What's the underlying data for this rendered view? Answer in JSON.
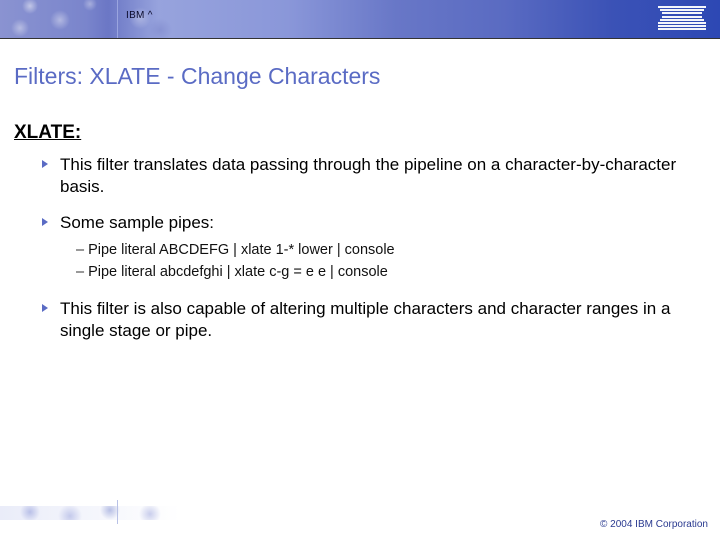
{
  "header": {
    "brand_left": "IBM ^",
    "brand_right_alt": "IBM"
  },
  "title": "Filters: XLATE - Change Characters",
  "section_heading": "XLATE:",
  "bullets": [
    {
      "text": "This filter translates data passing through the pipeline on a character-by-character basis."
    },
    {
      "text": "Some sample pipes:",
      "sub": [
        "Pipe literal ABCDEFG | xlate 1-* lower | console",
        "Pipe literal abcdefghi | xlate c-g = e e | console"
      ]
    },
    {
      "text": "This filter is also capable of altering multiple characters and character ranges in a single stage or pipe."
    }
  ],
  "footer": {
    "copyright": "© 2004 IBM Corporation"
  }
}
